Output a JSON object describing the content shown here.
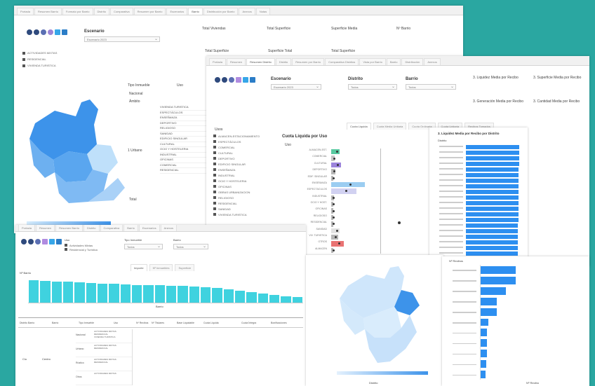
{
  "windows": {
    "back": {
      "tabs": [
        "Portada",
        "Resumen Barrio",
        "Formato por Barrio",
        "Distrito",
        "Comparativa ",
        "Resumen por Barrio",
        "Escenarios",
        "Barrio",
        "Distribución por Barrio",
        "Anexos",
        "Notas"
      ],
      "active_tab": 7,
      "escenario_label": "Escenario",
      "escenario_value": "Escenario 2023",
      "header_fields": [
        "Total Viviendas",
        "Total Superficie",
        "Superficie Media",
        "Nº Barrio"
      ],
      "header_fields2": [
        "Total Superficie",
        "Superficie Total",
        "Total Superficie"
      ],
      "legend": [
        "ACTIVIDADES MIXTAS",
        "RESIDENCIAL",
        "VIVIENDA TURISTICA"
      ],
      "table_header": [
        "Tipo Inmueble",
        "Uso"
      ],
      "table_rows": [
        "Nacional",
        "Ámbito"
      ],
      "uso_list": [
        "VIVIENDA TURISTICA",
        "ESPECTÁCULOS",
        "ENSEÑANZA",
        "DEPORTIVO",
        "RELIGIOSO",
        "SANIDAD",
        "EDIFICIO SINGULAR",
        "CULTURAL",
        "OCIO Y HOSTELERIA",
        "INDUSTRIAL",
        "OFICINAS",
        "COMERCIAL",
        "RESIDENCIAL"
      ],
      "tipo_label": "1 Urbano",
      "total_label": "Total"
    },
    "mid": {
      "tabs": [
        "Portada",
        "Resumen",
        "Resumen Distrito",
        "Distrito",
        "Resumen por Barrio",
        "Comparativa Distritos",
        "Vista por Barrio",
        "Barrio",
        "Distribución",
        "Anexos"
      ],
      "active_tab": 2,
      "escenario_label": "Escenario",
      "escenario_value": "Escenario 2023",
      "distrito_label": "Distrito",
      "distrito_value": "Todos",
      "barrio_label": "Barrio",
      "barrio_value": "Todos",
      "kpis": [
        "3. Liquidez Media por Recibo",
        "3. Superficie Media por Recibo",
        "3. Generación Media por Recibo",
        "3. Cantidad Media por Recibo"
      ],
      "subtabs": [
        "Cuota Liquida",
        "Cuota Media Unitaria",
        "Cuota Ordinaria",
        "Cuota Unitaria",
        "Recibos Tomados"
      ],
      "usos_title": "Usos",
      "usos_list": [
        "ALMACEN-ESTACIONAMIENTO",
        "ESPECTÁCULOS",
        "COMERCIAL",
        "CULTURAL",
        "DEPORTIVO",
        "EDIFICIO SINGULAR",
        "ENSEÑANZA",
        "INDUSTRIAL",
        "OCIO Y HOSTELERIA",
        "OFICINAS",
        "OBRAS URBANIZACION",
        "RELIGIOSO",
        "RESIDENCIAL",
        "SANIDAD",
        "VIVIENDA TURISTICA"
      ],
      "chart_title": "Cuota Liquida por Uso",
      "chart_axis": "Uso",
      "chart_rows": [
        {
          "label": "ALMACEN-EST.",
          "v": 0.1,
          "c": "#39c08f"
        },
        {
          "label": "COMERCIAL",
          "v": 0.04,
          "c": "#bbb"
        },
        {
          "label": "CULTURAL",
          "v": 0.12,
          "c": "#8b6fd6"
        },
        {
          "label": "DEPORTIVO",
          "v": 0.05,
          "c": "#aaa"
        },
        {
          "label": "EDIF. SINGULAR",
          "v": 0.02,
          "c": "#aaa"
        },
        {
          "label": "ENSEÑANZA",
          "v": 0.4,
          "c": "#8ac4ef"
        },
        {
          "label": "ESPECTÁCULOS",
          "v": 0.3,
          "c": "#c9c9ee"
        },
        {
          "label": "INDUSTRIAL",
          "v": 0.03,
          "c": "#aaa"
        },
        {
          "label": "OCIO Y HOST.",
          "v": 0.02,
          "c": "#aaa"
        },
        {
          "label": "OFICINAS",
          "v": 0.02,
          "c": "#aaa"
        },
        {
          "label": "RELIGIOSO",
          "v": 0.02,
          "c": "#aaa"
        },
        {
          "label": "RESIDENCIAL",
          "v": 0.02,
          "c": "#aaa"
        },
        {
          "label": "SANIDAD",
          "v": 0.1,
          "c": "#ddd"
        },
        {
          "label": "VIV. TURISTICA",
          "v": 0.08,
          "c": "#aaa"
        },
        {
          "label": "OTROS",
          "v": 0.15,
          "c": "#e55b5b"
        },
        {
          "label": "ALMACEN",
          "v": 0.02,
          "c": "#aaa"
        }
      ]
    },
    "right": {
      "title": "3. Liquidez Media por Recibo por Distrito",
      "subtitle": "Distrito",
      "bars": [
        0.95,
        0.95,
        0.95,
        0.95,
        0.94,
        0.94,
        0.94,
        0.94,
        0.94,
        0.94,
        0.94,
        0.94,
        0.94,
        0.94,
        0.93,
        0.93,
        0.93,
        0.93,
        0.93,
        0.93,
        0.93
      ]
    },
    "front_left": {
      "tabs": [
        "Portada",
        "Resumen",
        "Resumen Barrio",
        "Distrito",
        "Comparativa",
        "Barrio",
        "Escenarios",
        "Anexos"
      ],
      "uso_label": "Uso",
      "uso_items": [
        "Actividades Mixtas",
        "Residencial y Turistica"
      ],
      "tipo_label": "Tipo Inmueble",
      "tipo_value": "Todos",
      "barrio_label": "Barrio",
      "barrio_value": "Todos",
      "subtabs": [
        "Importe",
        "Nº Inmuebles",
        "Superficie"
      ],
      "chart_label": "Nº Barrio",
      "x_axis": "Barrio",
      "bars": [
        0.85,
        0.82,
        0.8,
        0.78,
        0.76,
        0.73,
        0.72,
        0.7,
        0.68,
        0.67,
        0.66,
        0.65,
        0.64,
        0.62,
        0.6,
        0.58,
        0.55,
        0.5,
        0.45,
        0.4,
        0.35,
        0.3,
        0.25,
        0.2
      ],
      "table_cols": [
        "Distrito Barrio",
        "Barrio",
        "Tipo Inmueble",
        "Uso",
        "Nº Recibos",
        "Nº Titulares",
        "Base Liquidable",
        "Cuota Liquida",
        "Cuota Íntegra",
        "Bonificaciones"
      ],
      "table_rows": [
        {
          "tipo": "Nacional",
          "uso": "ACTIVIDADES MIXTAS\nRESIDENCIAL\nVIVIENDA TURISTICA"
        },
        {
          "tipo": "Urbano",
          "uso": "ACTIVIDADES MIXTAS\nRESIDENCIAL"
        },
        {
          "tipo": "Rústico",
          "uso": "ACTIVIDADES MIXTAS\nRESIDENCIAL"
        },
        {
          "tipo": "Otros",
          "uso": "ACTIVIDADES MIXTAS"
        }
      ],
      "row_distrito": "Ciu",
      "row_barrio": "Centro"
    },
    "front_map": {
      "footer": "Distrito"
    },
    "front_right": {
      "title": "Nº Recibos",
      "bars": [
        0.55,
        0.55,
        0.4,
        0.25,
        0.25,
        0.12,
        0.1,
        0.1,
        0.1,
        0.09,
        0.08
      ],
      "footer": "Nº Recibo"
    }
  },
  "colors": {
    "frame": "#2aa7a1",
    "map_light": "#bfe0fa",
    "map_dark": "#3d93ea",
    "bar_teal": "#3fd2df",
    "bar_blue": "#2d8ff0"
  }
}
